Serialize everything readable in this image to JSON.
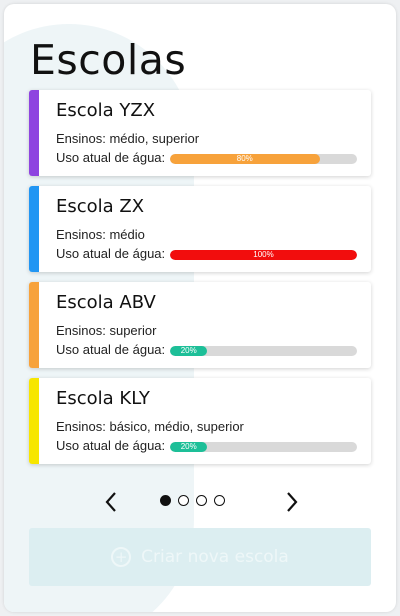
{
  "page": {
    "title": "Escolas"
  },
  "schools": [
    {
      "name": "Escola YZX",
      "levels": "Ensinos: médio, superior",
      "water_label": "Uso atual de água:",
      "usage_text": "80%",
      "usage_fraction": 0.8,
      "color": "#8e44e0",
      "bar_color": "#f7a23b"
    },
    {
      "name": "Escola ZX",
      "levels": "Ensinos: médio",
      "water_label": "Uso atual de água:",
      "usage_text": "100%",
      "usage_fraction": 1.0,
      "color": "#2196f3",
      "bar_color": "#f20d0d"
    },
    {
      "name": "Escola ABV",
      "levels": "Ensinos: superior",
      "water_label": "Uso atual de água:",
      "usage_text": "20%",
      "usage_fraction": 0.2,
      "color": "#f7a23b",
      "bar_color": "#1dbf98"
    },
    {
      "name": "Escola KLY",
      "levels": "Ensinos: básico, médio, superior",
      "water_label": "Uso atual de água:",
      "usage_text": "20%",
      "usage_fraction": 0.2,
      "color": "#f7e600",
      "bar_color": "#1dbf98"
    }
  ],
  "pagination": {
    "pages": 4,
    "current": 1,
    "prev_icon": "chevron-left-icon",
    "next_icon": "chevron-right-icon"
  },
  "create_button": {
    "label": "Criar nova escola",
    "icon": "plus-circle-icon"
  }
}
